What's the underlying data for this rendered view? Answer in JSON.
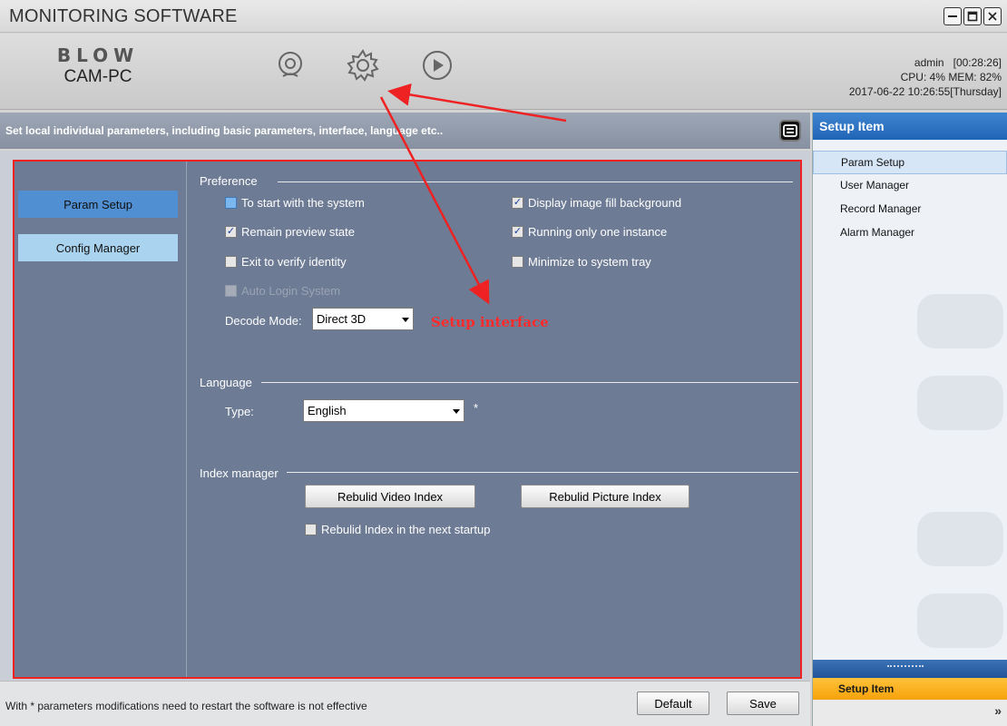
{
  "window": {
    "title": "MONITORING SOFTWARE",
    "controls": [
      "minimize-icon",
      "maximize-icon",
      "close-icon"
    ]
  },
  "header": {
    "brand_logo": "BLOW",
    "brand_model": "CAM-PC",
    "nav_icons": [
      "camera-icon",
      "gear-icon",
      "play-icon"
    ],
    "user": "admin",
    "session_time": "[00:28:26]",
    "cpu": "CPU: 4%",
    "mem": "MEM: 82%",
    "datetime": "2017-06-22 10:26:55[Thursday]"
  },
  "description": "Set local individual parameters, including basic parameters, interface, language etc..",
  "left_nav": [
    {
      "label": "Param Setup",
      "active": true
    },
    {
      "label": "Config Manager",
      "active": false
    }
  ],
  "preference": {
    "title": "Preference",
    "options": {
      "start_with_system": {
        "label": "To start with the system",
        "checked": false
      },
      "display_fill_bg": {
        "label": "Display image fill background",
        "checked": true
      },
      "remain_preview": {
        "label": "Remain preview state",
        "checked": true
      },
      "single_instance": {
        "label": "Running only one instance",
        "checked": true
      },
      "exit_verify": {
        "label": "Exit to verify identity",
        "checked": false
      },
      "minimize_tray": {
        "label": "Minimize to system tray",
        "checked": false
      },
      "auto_login": {
        "label": "Auto Login System",
        "checked": false,
        "disabled": true
      }
    },
    "decode_mode_label": "Decode Mode:",
    "decode_mode_value": "Direct 3D"
  },
  "annotation": {
    "label": "Setup interface",
    "color": "#ff2b2b"
  },
  "language": {
    "title": "Language",
    "type_label": "Type:",
    "type_value": "English",
    "restart_marker": "*"
  },
  "index_manager": {
    "title": "Index manager",
    "rebuild_video": "Rebulid Video Index",
    "rebuild_picture": "Rebulid Picture Index",
    "rebuild_next_startup": {
      "label": "Rebulid Index in the next startup",
      "checked": false
    }
  },
  "footer": {
    "note": "With * parameters modifications need to restart the software is not effective",
    "default_label": "Default",
    "save_label": "Save"
  },
  "right_panel": {
    "title": "Setup Item",
    "items": [
      {
        "label": "Param Setup",
        "selected": true
      },
      {
        "label": "User Manager",
        "selected": false
      },
      {
        "label": "Record Manager",
        "selected": false
      },
      {
        "label": "Alarm Manager",
        "selected": false
      }
    ],
    "footer_label": "Setup Item",
    "more_glyph": "»"
  },
  "colors": {
    "accent_blue": "#4f8fd2",
    "panel_bg": "#6d7b95",
    "annotation_red": "#ff2b2b",
    "setup_footer": "#f6a20a"
  }
}
